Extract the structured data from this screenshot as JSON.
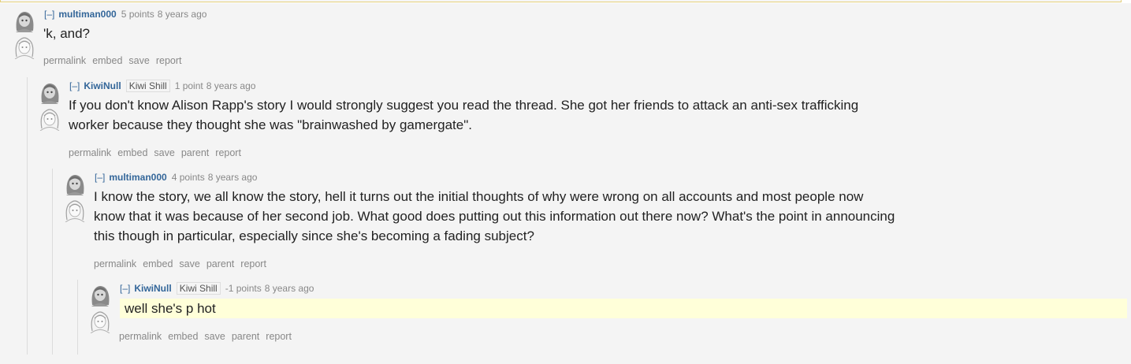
{
  "comments": [
    {
      "expand": "[–]",
      "author": "multiman000",
      "flair": "",
      "score": "5 points",
      "time": "8 years ago",
      "body": "'k, and?",
      "buttons": [
        "permalink",
        "embed",
        "save",
        "report"
      ]
    },
    {
      "expand": "[–]",
      "author": "KiwiNull",
      "flair": "Kiwi Shill",
      "score": "1 point",
      "time": "8 years ago",
      "body_lines": [
        "If you don't know Alison Rapp's story I would strongly suggest you read the thread. She got her friends to attack an anti-sex trafficking",
        "worker because they thought she was \"brainwashed by gamergate\"."
      ],
      "buttons": [
        "permalink",
        "embed",
        "save",
        "parent",
        "report"
      ]
    },
    {
      "expand": "[–]",
      "author": "multiman000",
      "flair": "",
      "score": "4 points",
      "time": "8 years ago",
      "body_lines": [
        "I know the story, we all know the story, hell it turns out the initial thoughts of why were wrong on all accounts and most people now",
        "know that it was because of her second job. What good does putting out this information out there now? What's the point in announcing",
        "this though in particular, especially since she's becoming a fading subject?"
      ],
      "buttons": [
        "permalink",
        "embed",
        "save",
        "parent",
        "report"
      ]
    },
    {
      "expand": "[–]",
      "author": "KiwiNull",
      "flair": "Kiwi Shill",
      "score": "-1 points",
      "time": "8 years ago",
      "body": "well she's p hot",
      "buttons": [
        "permalink",
        "embed",
        "save",
        "parent",
        "report"
      ]
    }
  ],
  "colors": {
    "author": "#336699",
    "highlight": "#ffffd9",
    "meta": "#888888"
  },
  "icons": {
    "avatar_top": "anime-girl-avatar-icon",
    "avatar_bottom": "anime-girl-sketch-icon"
  }
}
